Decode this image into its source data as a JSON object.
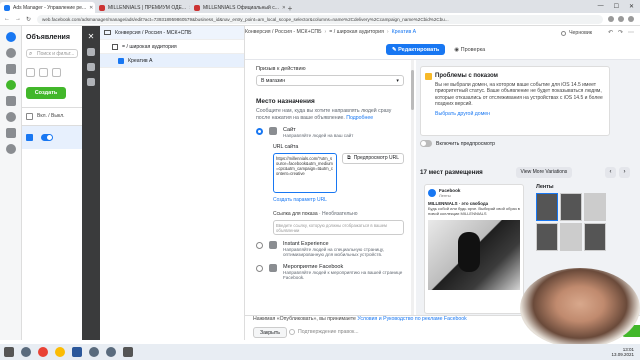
{
  "browser": {
    "tabs": [
      {
        "label": "Ads Manager - Управление ре...",
        "favicon": "fb"
      },
      {
        "label": "MILLENNIALS | ПРЕМИУМ ОДЕ...",
        "favicon": "red"
      },
      {
        "label": "MILLENNIALS Официальный с...",
        "favicon": "red"
      }
    ],
    "new_tab": "+",
    "url": "web.facebook.com/adsmanager/manage/ads/edit?act=739318959860579&business_id&nav_entry_point=am_local_scope_selector&columns=name%2Cdelivery%2Ccampaign_name%2Cbid%2Cbu..."
  },
  "left_panel": {
    "title": "Объявления",
    "search_placeholder": "Поиск и фильт...",
    "create_label": "Создать",
    "col_header": "Вкл. / Выкл."
  },
  "tree": {
    "campaign": "Конверсия / Россия - МСК+СПБ",
    "adset": "= / широкая аудитория",
    "ad": "Креатив А"
  },
  "topbar": {
    "crumbs": [
      "Конверсия / Россия - МСК+СПБ",
      "= / широкая аудитория",
      "Креатив А"
    ],
    "status": "Черновик",
    "edit_label": "Редактировать",
    "preview_label": "Проверка"
  },
  "form": {
    "cta_label": "Призыв к действию",
    "cta_value": "В магазин",
    "dest_title": "Место назначения",
    "dest_desc": "Сообщите нам, куда вы хотите направлять людей сразу после нажатия на ваше объявление.",
    "dest_more": "Подробнее",
    "site_title": "Сайт",
    "site_sub": "Направляйте людей на ваш сайт",
    "url_label": "URL сайта",
    "url_value": "https://millennials.com/?utm_source=facebook&utm_medium=cpc&utm_campaign=t&utm_content=creative",
    "url_preview": "Предпросмотр URL",
    "build_param": "Создать параметр URL",
    "show_link_label": "Ссылка для показа",
    "show_link_optional": "· Необязательно",
    "show_link_placeholder": "Введите ссылку, которую должны отображаться в вашем объявлении",
    "instant_title": "Instant Experience",
    "instant_sub": "Направляйте людей на специальную страницу, оптимизированную для мобильных устройств.",
    "event_title": "Мероприятие Facebook",
    "event_sub": "Направляйте людей к мероприятию на вашей странице Facebook."
  },
  "right": {
    "warn_title": "Проблемы с показом",
    "warn_text": "Вы не выбрали домен, на котором ваше событие для iOS 14.5 имеет приоритетный статус. Ваше объявление не будет показываться людям, которые отказались от отслеживания на устройствах с iOS 14.5 и более поздних версий.",
    "warn_link": "Выбрать другой домен",
    "preview_toggle": "Включить предпросмотр",
    "placements": "17 мест размещения",
    "view_more": "View More Variations",
    "ad_page": "Facebook",
    "ad_sub": "Ленты",
    "ad_account": "MILLENNIALS · это свобода",
    "ad_caption": "Будь собой или будь ярче. Выбирай свой образ в новой коллекции MILLENNIALS",
    "feeds_title": "Ленты"
  },
  "bottom": {
    "text_pre": "Нажимая «Опубликовать», вы принимаете",
    "text_link": "Условия и Руководство по рекламе Facebook",
    "close_label": "Закрыть",
    "confirm_label": "Подтверждение правок..."
  },
  "taskbar": {
    "time": "13:01",
    "date": "13.09.2021"
  }
}
